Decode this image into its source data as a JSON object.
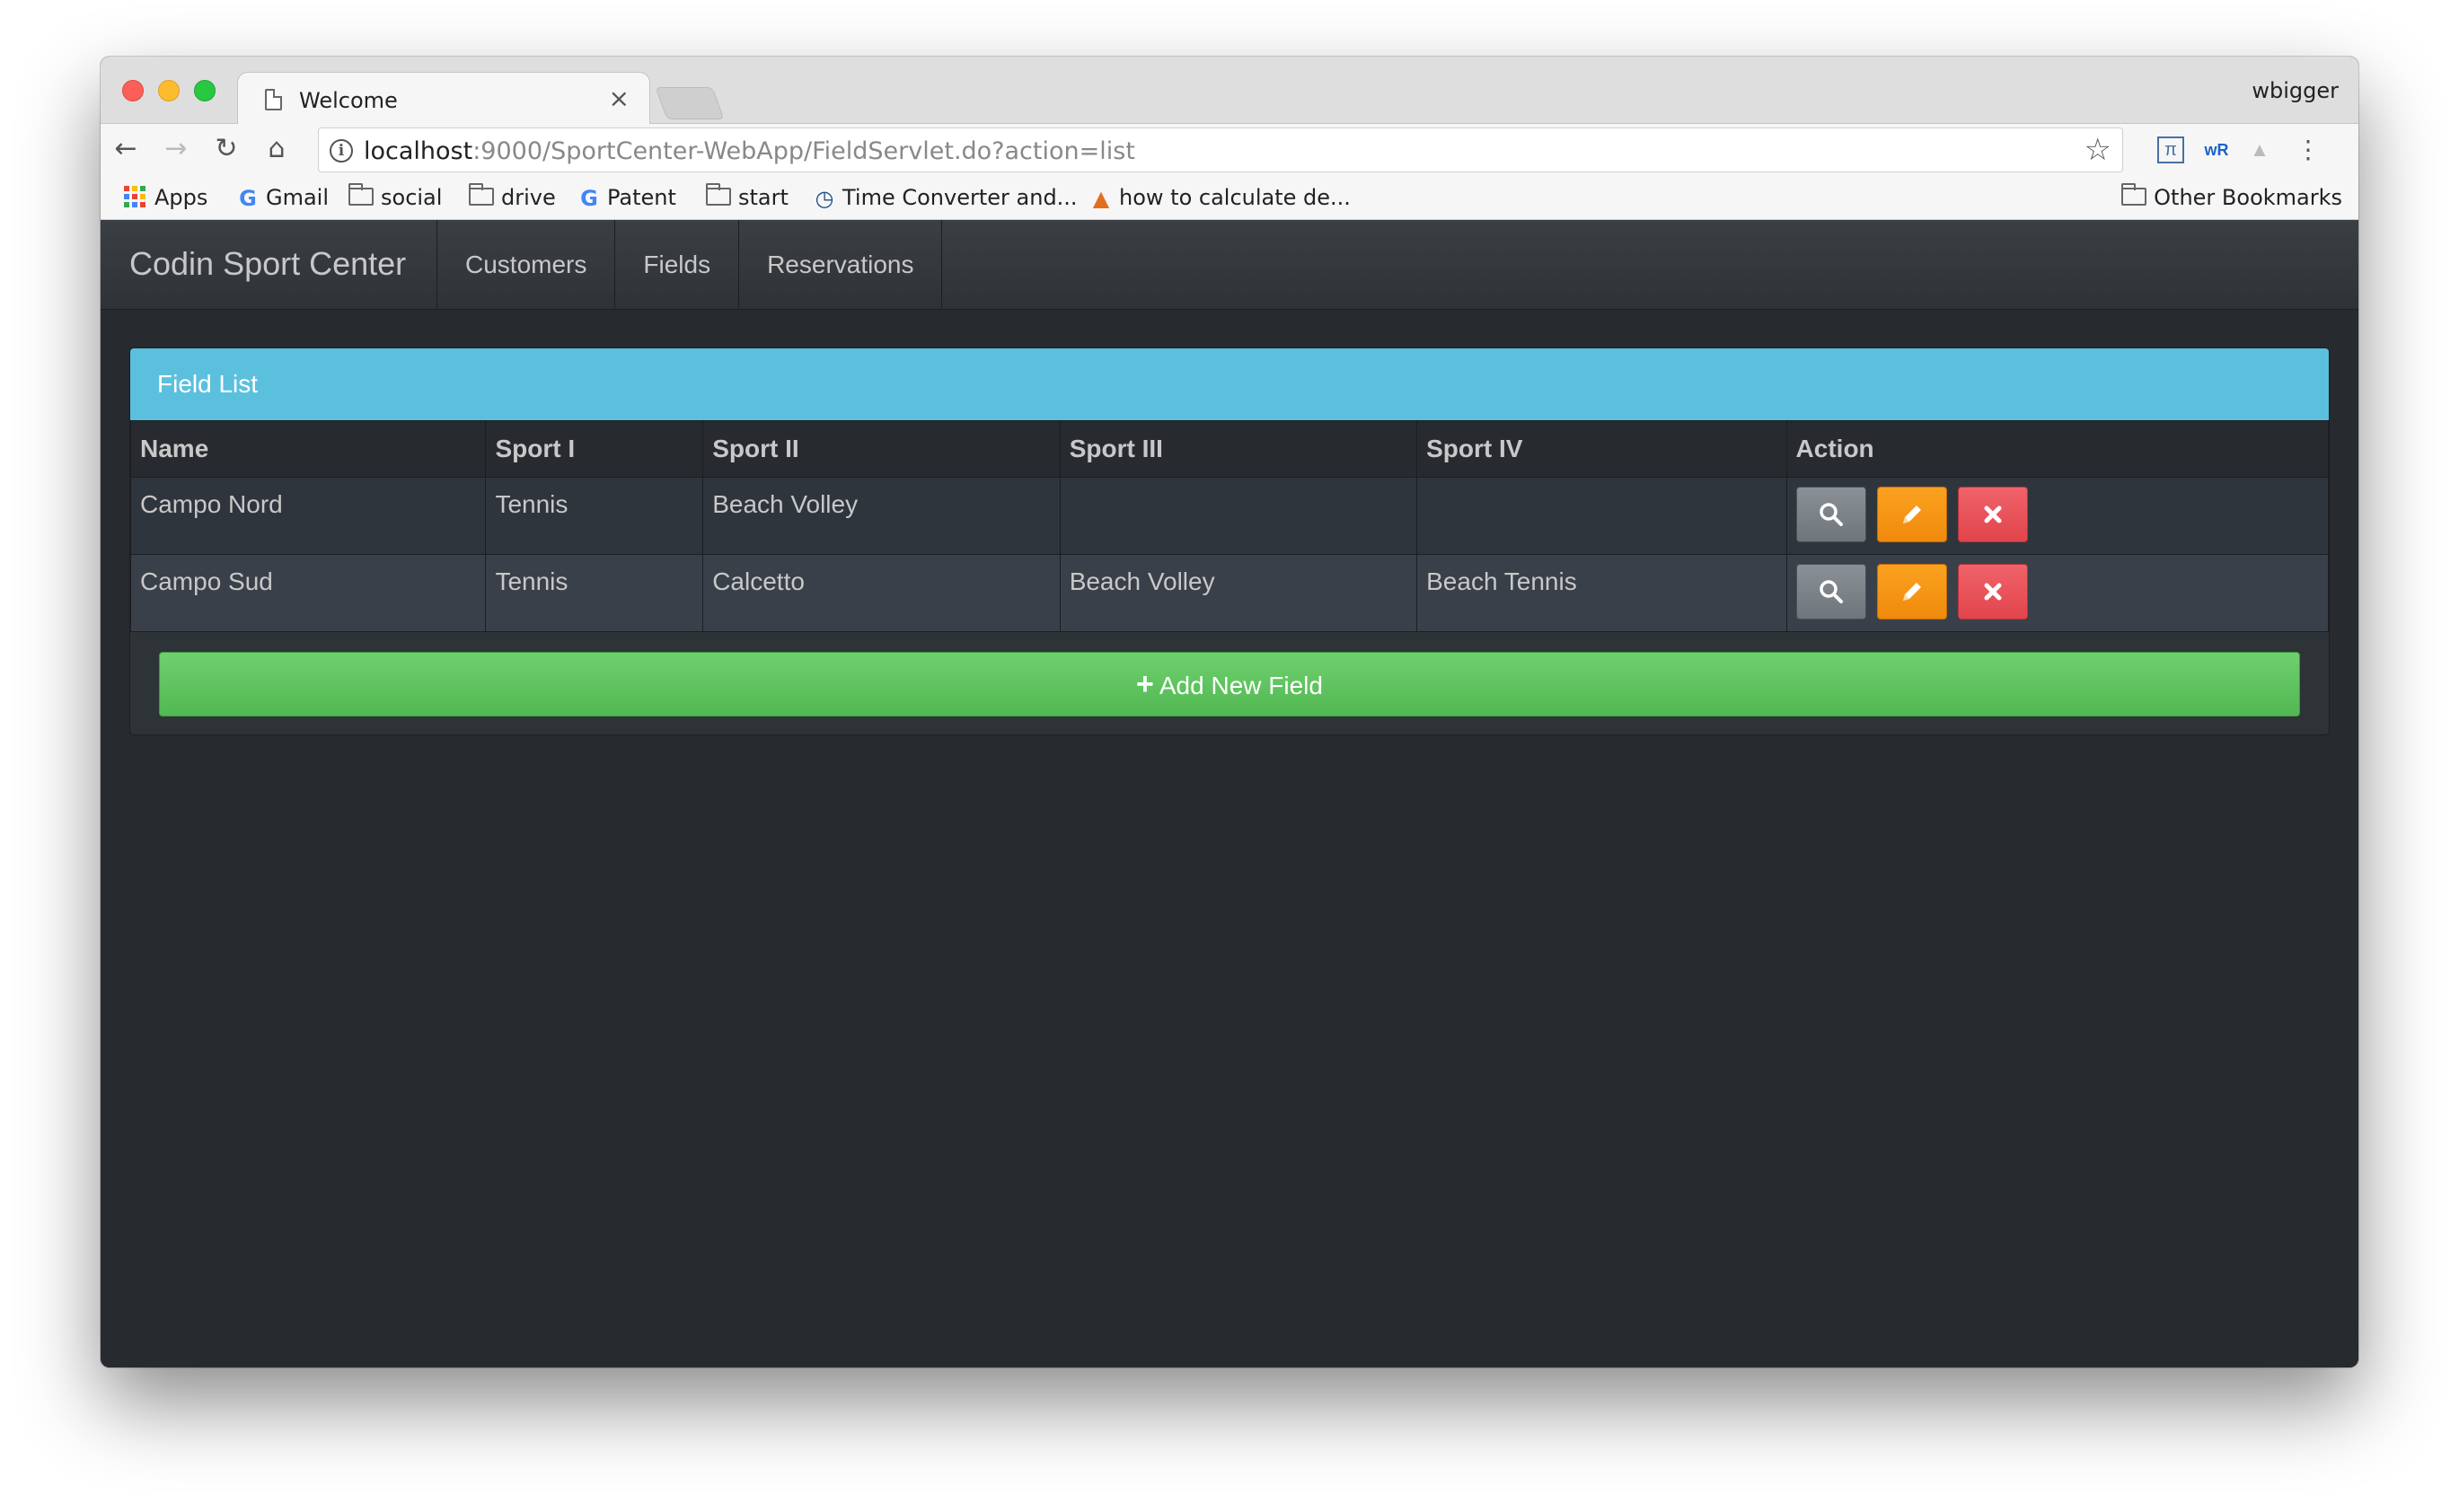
{
  "browser": {
    "tab_title": "Welcome",
    "tab_close": "×",
    "profile_name": "wbigger",
    "url_host": "localhost",
    "url_rest": ":9000/SportCenter-WebApp/FieldServlet.do?action=list",
    "bookmarks": [
      {
        "label": "Apps",
        "icon": "apps-grid-icon"
      },
      {
        "label": "Gmail",
        "icon": "google-icon"
      },
      {
        "label": "social",
        "icon": "folder-icon"
      },
      {
        "label": "drive",
        "icon": "folder-icon"
      },
      {
        "label": "Patent",
        "icon": "google-icon"
      },
      {
        "label": "start",
        "icon": "folder-icon"
      },
      {
        "label": "Time Converter and...",
        "icon": "clock-icon"
      },
      {
        "label": "how to calculate de...",
        "icon": "matlab-icon"
      }
    ],
    "other_bookmarks": "Other Bookmarks"
  },
  "app": {
    "brand": "Codin Sport Center",
    "nav": [
      "Customers",
      "Fields",
      "Reservations"
    ]
  },
  "panel": {
    "title": "Field List",
    "columns": [
      "Name",
      "Sport I",
      "Sport II",
      "Sport III",
      "Sport IV",
      "Action"
    ],
    "rows": [
      {
        "name": "Campo Nord",
        "sport1": "Tennis",
        "sport2": "Beach Volley",
        "sport3": "",
        "sport4": ""
      },
      {
        "name": "Campo Sud",
        "sport1": "Tennis",
        "sport2": "Calcetto",
        "sport3": "Beach Volley",
        "sport4": "Beach Tennis"
      }
    ],
    "add_label": "Add New Field"
  },
  "colors": {
    "panel_heading": "#5bc0de",
    "view_button": "#7a8288",
    "edit_button": "#f89406",
    "delete_button": "#ee5f5b",
    "add_button": "#62c462"
  }
}
